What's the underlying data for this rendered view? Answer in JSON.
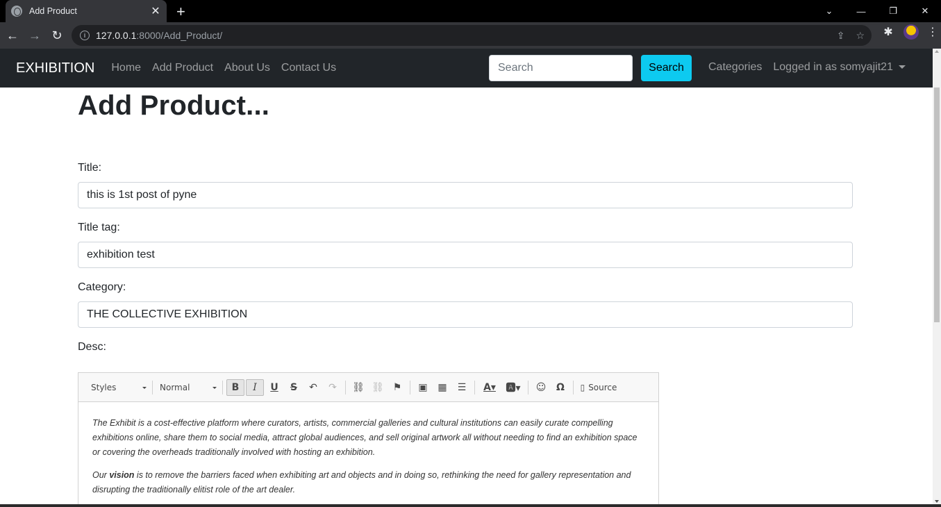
{
  "browser": {
    "tab_title": "Add Product",
    "tab_close": "✕",
    "new_tab": "+",
    "url_host": "127.0.0.1",
    "url_path": ":8000/Add_Product/"
  },
  "navbar": {
    "brand": "EXHIBITION",
    "links": [
      "Home",
      "Add Product",
      "About Us",
      "Contact Us"
    ],
    "search_placeholder": "Search",
    "search_button": "Search",
    "categories": "Categories",
    "user": "Logged in as somyajit21"
  },
  "page": {
    "heading": "Add Product...",
    "title_label": "Title:",
    "title_value": "this is 1st post of pyne",
    "title_tag_label": "Title tag:",
    "title_tag_value": "exhibition test",
    "category_label": "Category:",
    "category_value": "THE COLLECTIVE EXHIBITION",
    "desc_label": "Desc:"
  },
  "editor": {
    "styles": "Styles",
    "format": "Normal",
    "source": "Source",
    "para1": "The Exhibit is a cost-effective platform where curators, artists, commercial galleries and cultural institutions can easily curate compelling exhibitions online, share them to social media, attract global audiences, and sell original artwork all without needing to find an exhibition space or covering the overheads traditionally involved with hosting an exhibition.",
    "para2_before": "Our ",
    "para2_bold": "vision",
    "para2_after": " is to remove the barriers faced when exhibiting art and objects and in doing so, rethinking the need for gallery representation and disrupting the traditionally elitist role of the art dealer."
  }
}
